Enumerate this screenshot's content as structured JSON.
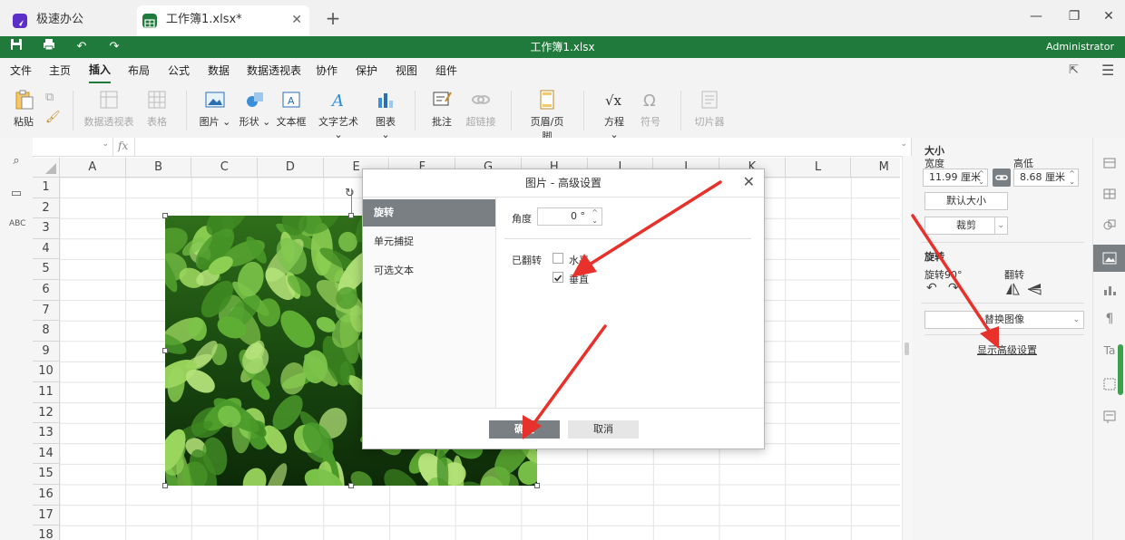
{
  "tabs": {
    "app_title": "极速办公",
    "doc_title": "工作簿1.xlsx*",
    "new_tab": "+"
  },
  "titlebar": {
    "doc_name": "工作簿1.xlsx",
    "user": "Administrator"
  },
  "menu": [
    "文件",
    "主页",
    "插入",
    "布局",
    "公式",
    "数据",
    "数据透视表",
    "协作",
    "保护",
    "视图",
    "组件"
  ],
  "menu_active": "插入",
  "ribbon": {
    "paste": "粘贴",
    "pivot": "数据透视表",
    "table": "表格",
    "picture": "图片",
    "shape": "形状",
    "textbox": "文本框",
    "wordart": "文字艺术",
    "chart": "图表",
    "comment": "批注",
    "hyperlink": "超链接",
    "header_footer": "页眉/页脚",
    "equation": "方程",
    "symbol": "符号",
    "slicer": "切片器"
  },
  "formula_bar": {
    "fx": "fx"
  },
  "columns": [
    "A",
    "B",
    "C",
    "D",
    "E",
    "F",
    "G",
    "H",
    "I",
    "J",
    "K",
    "L",
    "M"
  ],
  "rows": [
    "1",
    "2",
    "3",
    "4",
    "5",
    "6",
    "7",
    "8",
    "9",
    "10",
    "11",
    "12",
    "13",
    "14",
    "15",
    "16",
    "17",
    "18"
  ],
  "dialog": {
    "title": "图片 - 高级设置",
    "nav": [
      "旋转",
      "单元捕捉",
      "可选文本"
    ],
    "angle_label": "角度",
    "angle_value": "0 °",
    "flipped_label": "已翻转",
    "horizontal_label": "水平",
    "vertical_label": "垂直",
    "horizontal_checked": false,
    "vertical_checked": true,
    "ok": "确定",
    "cancel": "取消"
  },
  "panel": {
    "size_title": "大小",
    "width_label": "宽度",
    "height_label": "高低",
    "width_value": "11.99 厘米",
    "height_value": "8.68 厘米",
    "default_size": "默认大小",
    "crop": "裁剪",
    "rotate_title": "旋转",
    "rotate90": "旋转90°",
    "flip": "翻转",
    "replace_image": "替换图像",
    "advanced": "显示高级设置"
  },
  "colors": {
    "brand_green": "#1f7a3b",
    "annotation_red": "#e8312a",
    "nav_active": "#7a7f84"
  }
}
